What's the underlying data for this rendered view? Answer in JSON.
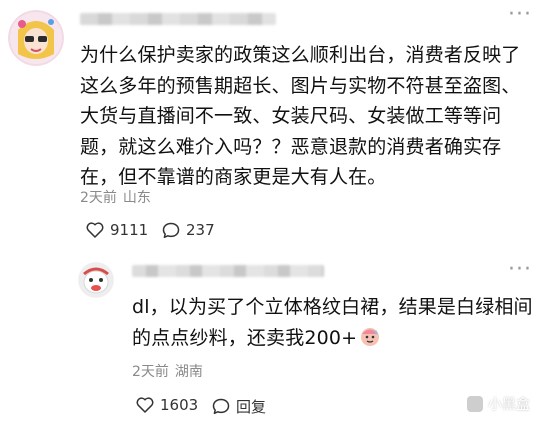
{
  "main_comment": {
    "more_label": "···",
    "text": "为什么保护卖家的政策这么顺利出台，消费者反映了这么多年的预售期超长、图片与实物不符甚至盗图、大货与直播间不一致、女装尺码、女装做工等等问题，就这么难介入吗？？恶意退款的消费者确实存在，但不靠谱的商家更是大有人在。",
    "time": "2天前",
    "location": "山东",
    "likes": "9111",
    "replies": "237"
  },
  "reply": {
    "more_label": "···",
    "text": "dl，以为买了个立体格纹白裙，结果是白绿相间的点点纱料，还卖我200+",
    "emoji": "sweat-smile-emoji",
    "time": "2天前",
    "location": "湖南",
    "likes": "1603",
    "reply_label": "回复"
  },
  "watermark": {
    "text": "小黑盒"
  },
  "icons": {
    "like": "heart-outline-icon",
    "comment": "speech-bubble-icon",
    "more": "more-dots-icon"
  },
  "colors": {
    "text": "#111111",
    "meta": "#8a8a8a",
    "action": "#333333"
  }
}
